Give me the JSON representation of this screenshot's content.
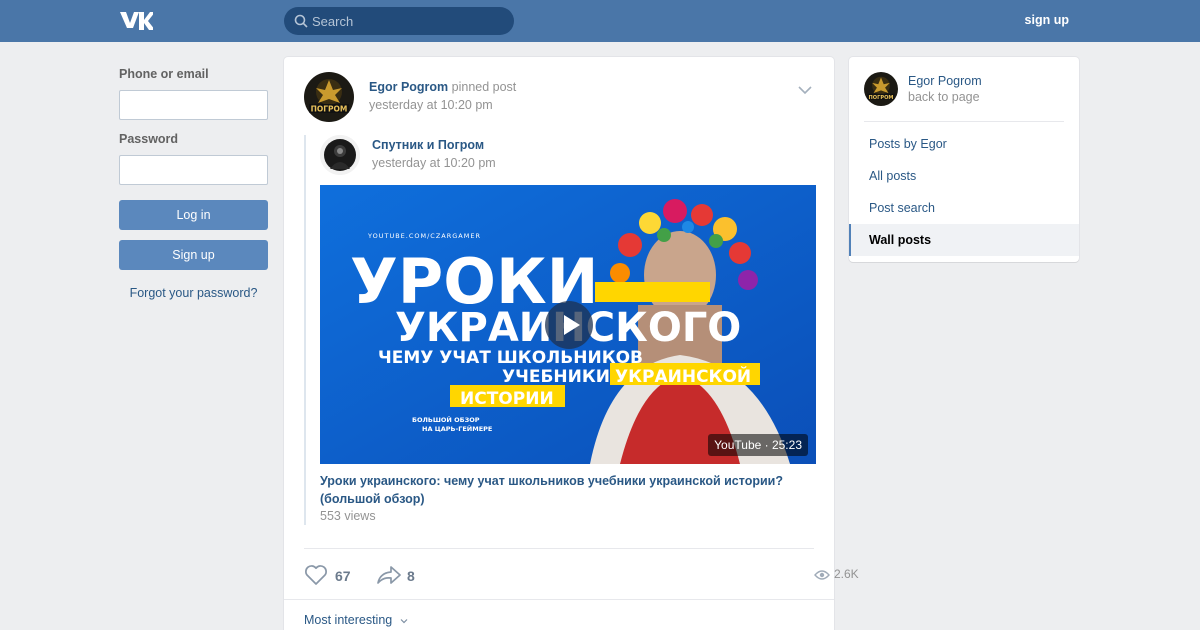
{
  "header": {
    "logo": "vk-logo",
    "search_placeholder": "Search",
    "signup_label": "sign up",
    "colors": {
      "bar": "#4a76a8",
      "search_bg": "#224b7a"
    }
  },
  "login": {
    "phone_label": "Phone or email",
    "password_label": "Password",
    "login_button": "Log in",
    "signup_button": "Sign up",
    "forgot_link": "Forgot your password?"
  },
  "post": {
    "author": "Egor Pogrom",
    "pinned_text": " pinned post",
    "time": "yesterday at 10:20 pm",
    "repost": {
      "author": "Спутник и Погром",
      "time": "yesterday at 10:20 pm",
      "video": {
        "thumb_channel": "YOUTUBE.COM/CZARGAMER",
        "thumb_line1": "УРОКИ",
        "thumb_line2": "УКРАИНСКОГО",
        "thumb_line3": "ЧЕМУ УЧАТ ШКОЛЬНИКОВ",
        "thumb_line4_a": "УЧЕБНИКИ ",
        "thumb_line4_b": "УКРАИНСКОЙ",
        "thumb_line5": "ИСТОРИИ",
        "thumb_small1": "БОЛЬШОЙ ОБЗОР",
        "thumb_small2": "НА ЦАРЬ-ГЕЙМЕРЕ",
        "badge": "YouTube · 25:23",
        "title": "Уроки украинского: чему учат школьников учебники украинской истории? (большой обзор)",
        "views": "553 views"
      }
    },
    "likes": "67",
    "shares": "8",
    "views": "2.6K",
    "sort_label": "Most interesting"
  },
  "avatar_text": "ПОГРОМ",
  "sidebar": {
    "name": "Egor Pogrom",
    "back": "back to page",
    "items": [
      {
        "label": "Posts by Egor",
        "active": false
      },
      {
        "label": "All posts",
        "active": false
      },
      {
        "label": "Post search",
        "active": false
      },
      {
        "label": "Wall posts",
        "active": true
      }
    ]
  }
}
